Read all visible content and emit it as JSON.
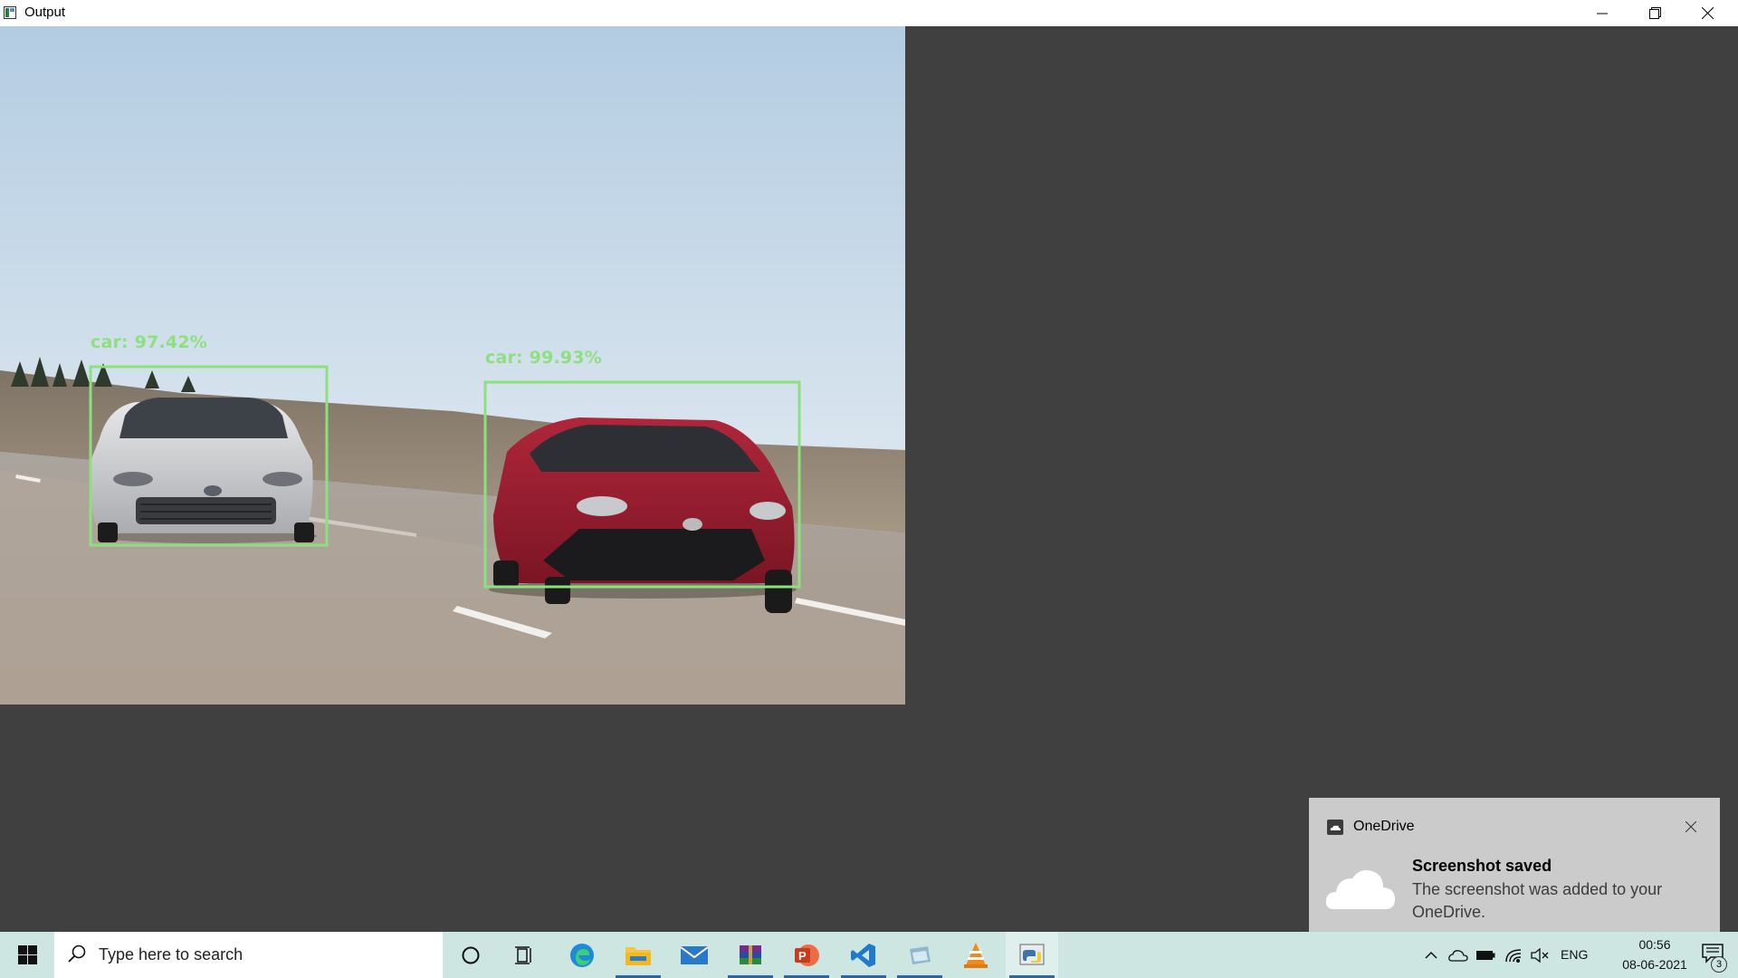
{
  "window": {
    "title": "Output"
  },
  "detections": [
    {
      "label": "car: 97.42%",
      "color": "#8de07e"
    },
    {
      "label": "car: 99.93%",
      "color": "#8de07e"
    }
  ],
  "toast": {
    "app_name": "OneDrive",
    "heading": "Screenshot saved",
    "body": "The screenshot was added to your OneDrive."
  },
  "taskbar": {
    "search_placeholder": "Type here to search",
    "pinned": [
      "cortana-icon",
      "task-view-icon",
      "edge-icon",
      "file-explorer-icon",
      "mail-icon",
      "winrar-icon",
      "powerpoint-icon",
      "vscode-icon",
      "app-icon",
      "vlc-icon",
      "python-icon"
    ],
    "tray": {
      "language": "ENG",
      "time": "00:56",
      "date": "08-06-2021",
      "notification_count": "3"
    }
  },
  "colors": {
    "titlebar": "#ffffff",
    "client_bg": "#404040",
    "taskbar": "#cde6e2",
    "toast": "#cbcbcb",
    "detection_box": "#8de07e"
  }
}
